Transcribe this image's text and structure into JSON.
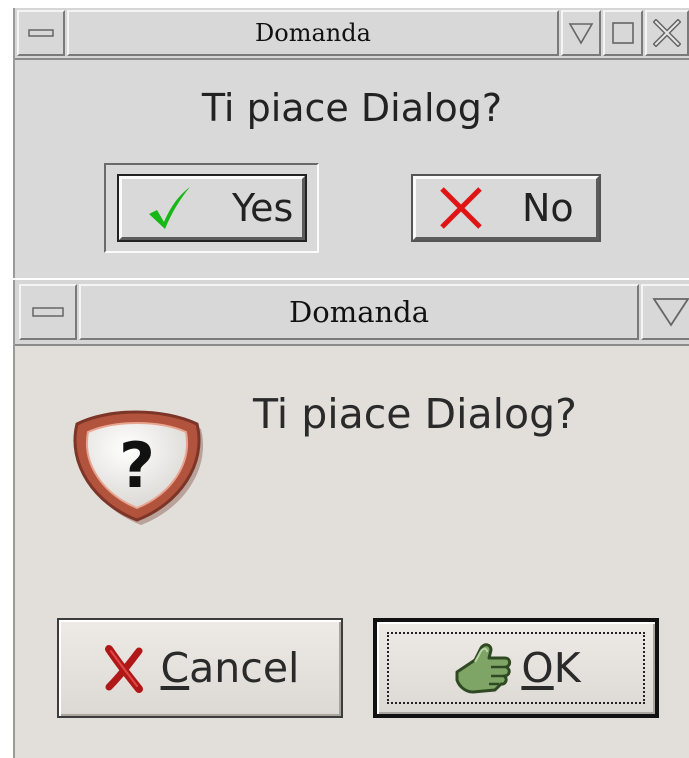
{
  "dialog_tk": {
    "title": "Domanda",
    "message": "Ti piace Dialog?",
    "buttons": {
      "yes": {
        "label": "Yes",
        "icon": "checkmark-icon",
        "color": "#16b816"
      },
      "no": {
        "label": "No",
        "icon": "x-icon",
        "color": "#e01414"
      }
    },
    "titlebar_icons": [
      "window-menu-icon",
      "shade-icon",
      "maximize-icon",
      "close-icon"
    ]
  },
  "dialog_gtk": {
    "title": "Domanda",
    "message": "Ti piace Dialog?",
    "icon": "question-icon",
    "buttons": {
      "cancel": {
        "mnemonic": "C",
        "rest": "ancel",
        "icon": "cancel-x-icon",
        "color": "#b01818"
      },
      "ok": {
        "mnemonic": "O",
        "rest": "K",
        "icon": "ok-hand-icon",
        "color": "#6f9658"
      }
    },
    "titlebar_icons": [
      "window-menu-icon",
      "shade-icon"
    ]
  }
}
